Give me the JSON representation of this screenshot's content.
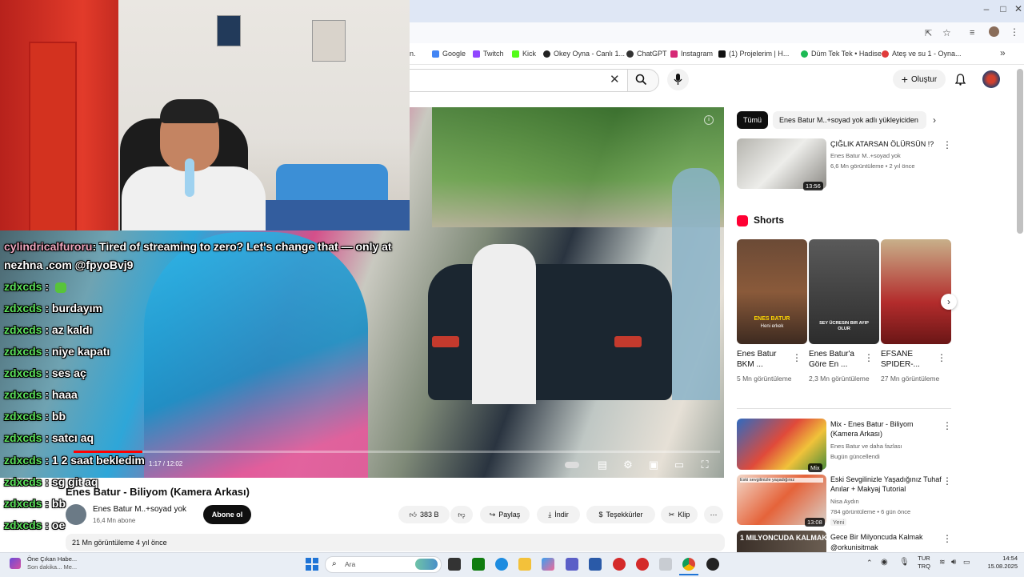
{
  "browser": {
    "bookmarks": [
      "Google",
      "Twitch",
      "Kick",
      "Okey Oyna - Canlı 1...",
      "ChatGPT",
      "Instagram",
      "(1) Projelerim | H...",
      "Düm Tek Tek • Hadise",
      "Ateş ve su 1 - Oyna..."
    ]
  },
  "youtube": {
    "create_label": "Oluştur",
    "player": {
      "time": "1:17 / 12:02",
      "progress": 0.106
    },
    "video_title": "Enes Batur - Biliyom (Kamera Arkası)",
    "channel": "Enes Batur M..+soyad yok",
    "subscribers": "16,4 Mn abone",
    "subscribe_label": "Abone ol",
    "actions": {
      "likes": "383 B",
      "share": "Paylaş",
      "download": "İndir",
      "thanks": "Teşekkürler",
      "clip": "Klip"
    },
    "description_meta": "21 Mn görüntüleme  4 yıl önce",
    "chips": [
      "Tümü",
      "Enes Batur M..+soyad yok adlı yükleyiciden"
    ],
    "recommended": [
      {
        "title": "ÇIĞLIK ATARSAN ÖLÜRSÜN !?",
        "channel": "Enes Batur M..+soyad yok",
        "meta": "6,6 Mn görüntüleme • 2 yıl önce",
        "duration": "13:56",
        "color": "#9a9a94"
      },
      {
        "title": "Mix - Enes Batur - Biliyom (Kamera Arkası)",
        "channel": "Enes Batur ve daha fazlası",
        "meta": "Bugün güncellendi",
        "duration": "Mix",
        "color": "#3b6fb8"
      },
      {
        "title": "Eski Sevgilinizle Yaşadığınız Tuhaf Anılar + Makyaj Tutorial",
        "channel": "Nisa Aydın",
        "meta": "784 görüntüleme • 6 gün önce",
        "badge": "Yeni",
        "duration": "13:08",
        "color": "#e5633a"
      },
      {
        "title": "Gece Bir Milyoncuda Kalmak",
        "channel": "@orkunisitmak",
        "color": "#6b5e52"
      }
    ],
    "shorts_heading": "Shorts",
    "shorts": [
      {
        "title": "Enes Batur BKM ...",
        "views": "5 Mn görüntüleme",
        "color": "#8a5a3a"
      },
      {
        "title": "Enes Batur'a Göre En ...",
        "views": "2,3 Mn görüntüleme",
        "color": "#4a4a4a"
      },
      {
        "title": "EFSANE SPIDER-...",
        "views": "27 Mn görüntüleme",
        "color": "#b8955f"
      }
    ],
    "short_overlays": {
      "s1_a": "ENES BATUR",
      "s1_b": "Heni erkek",
      "s2": "SEY ÜCRESIN BIR AYIP OLUR",
      "thumb3": "1 MILYONCUDA KALMAK",
      "thumb2": "Eski sevgilinizle yaşadığınız"
    }
  },
  "chat": [
    {
      "user": "cylindricalfuroru",
      "msg": ": Tired of streaming to zero? Let's change that — only at"
    },
    {
      "user": "",
      "msg": "nezhna .com @fpyoBvj9"
    },
    {
      "user": "zdxcds",
      "msg": " : ",
      "emote": true
    },
    {
      "user": "zdxcds",
      "msg": " : burdayım"
    },
    {
      "user": "zdxcds",
      "msg": " : az kaldı"
    },
    {
      "user": "zdxcds",
      "msg": " : niye kapatı"
    },
    {
      "user": "zdxcds",
      "msg": " : ses aç"
    },
    {
      "user": "zdxcds",
      "msg": " : haaa"
    },
    {
      "user": "zdxcds",
      "msg": " : bb"
    },
    {
      "user": "zdxcds",
      "msg": " : satcı aq"
    },
    {
      "user": "zdxcds",
      "msg": " : 1 2 saat bekledim"
    },
    {
      "user": "zdxcds",
      "msg": " : sg git aq"
    },
    {
      "user": "zdxcds",
      "msg": " : bb"
    },
    {
      "user": "zdxcds",
      "msg": " : oe"
    }
  ],
  "taskbar": {
    "notif_title": "Öne Çıkan Habe...",
    "notif_sub": "Son dakika... Me...",
    "search_placeholder": "Ara",
    "lang_top": "TUR",
    "lang_bottom": "TRQ",
    "time": "14:54",
    "date": "15.08.2025"
  }
}
